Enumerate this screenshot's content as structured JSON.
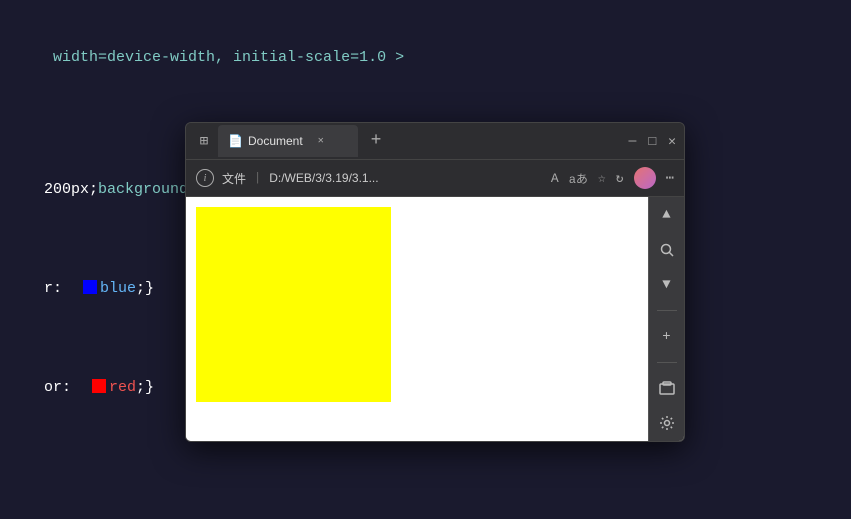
{
  "editor": {
    "lines": [
      {
        "id": "line1",
        "text": " width=device-width, initial-scale=1.0 >"
      },
      {
        "id": "line2",
        "text": ""
      },
      {
        "id": "line3",
        "yellow_color": "yellow",
        "suffix": ";}"
      },
      {
        "id": "line4",
        "prefix": "r: ",
        "blue_color": "blue",
        "suffix": "}"
      },
      {
        "id": "line5",
        "prefix": "or: ",
        "red_color": "red",
        "suffix": "}"
      }
    ]
  },
  "browser": {
    "tab": {
      "label": "Document",
      "favicon": "📄"
    },
    "addressbar": {
      "info_icon": "i",
      "file_label": "文件",
      "separator": "|",
      "path": "D:/WEB/3/3.19/3.1...",
      "tools": [
        "A",
        "aあ",
        "☆",
        "↻",
        "⋯"
      ]
    },
    "window_controls": {
      "minimize": "─",
      "maximize": "□",
      "close": "✕"
    },
    "sidebar_buttons": [
      "▲",
      "🔍",
      "▼",
      "+",
      "─",
      "⊞",
      "⚙"
    ]
  },
  "colors": {
    "editor_bg": "#1a1a2e",
    "browser_chrome": "#2d2d30",
    "tab_bg": "#3c3c3f",
    "yellow": "#ffff00",
    "blue": "#0000ff",
    "red": "#ff0000"
  }
}
